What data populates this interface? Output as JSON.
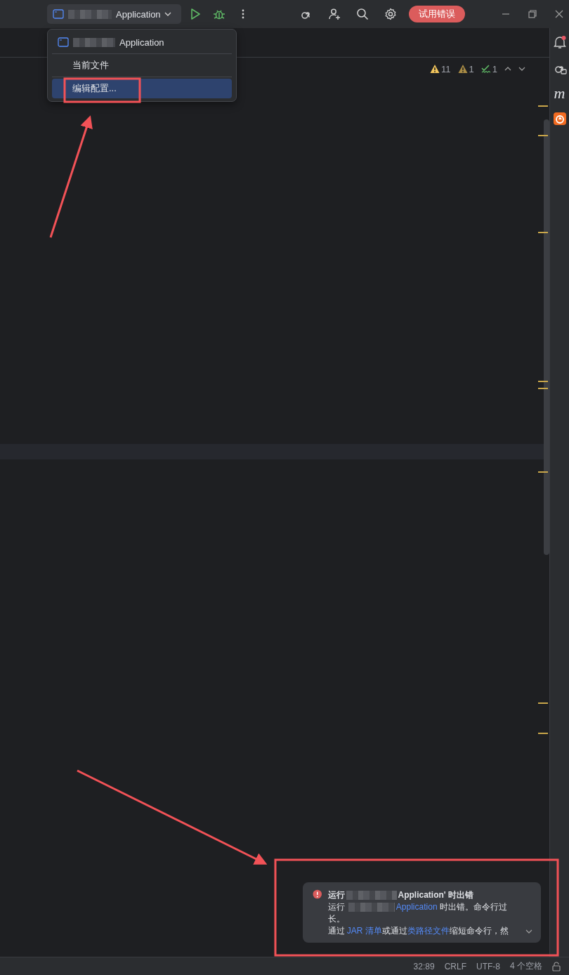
{
  "toolbar": {
    "run_config": {
      "label": "Application",
      "redacted": true
    },
    "trial_button": "试用错误"
  },
  "run_menu": {
    "items": [
      {
        "kind": "config",
        "label": "Application",
        "redacted": true,
        "selected": false
      },
      {
        "kind": "plain",
        "label": "当前文件",
        "selected": false
      },
      {
        "kind": "plain",
        "label": "编辑配置...",
        "selected": true
      }
    ]
  },
  "inspections": [
    {
      "kind": "warning",
      "count": "11"
    },
    {
      "kind": "weak-warning",
      "count": "1"
    },
    {
      "kind": "typo",
      "count": "1"
    }
  ],
  "side_strip": {
    "notification_badge": true,
    "text_icon": "m"
  },
  "notification": {
    "title": [
      {
        "kind": "text",
        "text": "运行"
      },
      {
        "kind": "redacted"
      },
      {
        "kind": "text",
        "text": "Application' 时出错"
      }
    ],
    "paragraphs": [
      [
        {
          "kind": "text",
          "text": "运行 "
        },
        {
          "kind": "redacted"
        },
        {
          "kind": "link",
          "text": "Application"
        },
        {
          "kind": "text",
          "text": " 时出错。命令行过长。"
        }
      ],
      [
        {
          "kind": "text",
          "text": "通过 "
        },
        {
          "kind": "link",
          "text": "JAR 清单"
        },
        {
          "kind": "text",
          "text": "或通过"
        },
        {
          "kind": "link",
          "text": "类路径文件"
        },
        {
          "kind": "text",
          "text": "缩短命令行，然"
        }
      ]
    ]
  },
  "status_bar": [
    "32:89",
    "CRLF",
    "UTF-8",
    "4 个空格"
  ],
  "annotations": [
    {
      "kind": "box"
    },
    {
      "kind": "arrow"
    },
    {
      "kind": "box"
    },
    {
      "kind": "arrow"
    }
  ]
}
